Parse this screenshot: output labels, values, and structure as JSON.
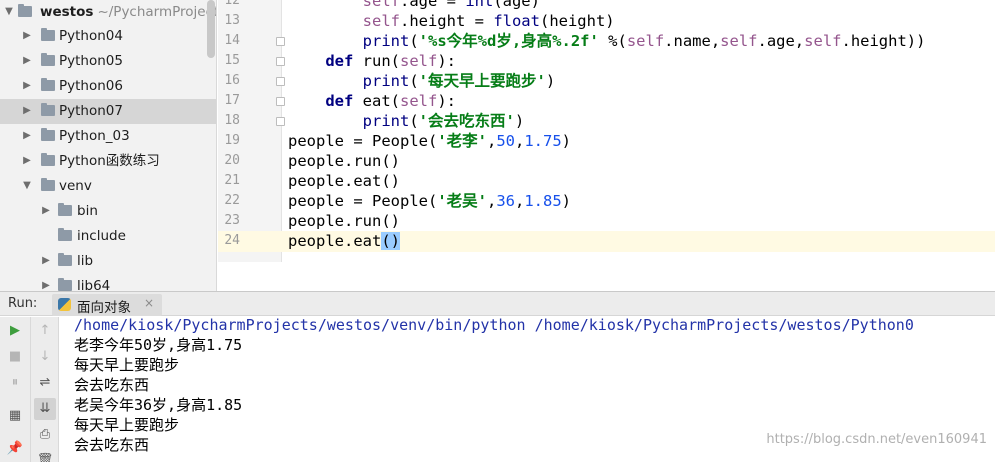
{
  "project_tree": {
    "root": {
      "name": "westos",
      "path": "~/PycharmProjects"
    },
    "items": [
      {
        "label": "Python04",
        "selected": false,
        "arrow": "▶"
      },
      {
        "label": "Python05",
        "selected": false,
        "arrow": "▶"
      },
      {
        "label": "Python06",
        "selected": false,
        "arrow": "▶"
      },
      {
        "label": "Python07",
        "selected": true,
        "arrow": "▶"
      },
      {
        "label": "Python_03",
        "selected": false,
        "arrow": "▶"
      },
      {
        "label": "Python函数练习",
        "selected": false,
        "arrow": "▶"
      },
      {
        "label": "venv",
        "selected": false,
        "arrow": "▼"
      },
      {
        "label": "bin",
        "selected": false,
        "arrow": "▶"
      },
      {
        "label": "include",
        "selected": false,
        "arrow": ""
      },
      {
        "label": "lib",
        "selected": false,
        "arrow": "▶"
      },
      {
        "label": "lib64",
        "selected": false,
        "arrow": "▶"
      }
    ]
  },
  "editor": {
    "line_numbers": [
      "13",
      "14",
      "15",
      "16",
      "17",
      "18",
      "19",
      "20",
      "21",
      "22",
      "23",
      "24"
    ],
    "current_line": "24",
    "top_partial_line": "self.age = int(age)"
  },
  "run_panel": {
    "title": "Run:",
    "tab_label": "面向对象",
    "tab_close": "×",
    "command": "/home/kiosk/PycharmProjects/westos/venv/bin/python /home/kiosk/PycharmProjects/westos/Python0",
    "output_lines": [
      "老李今年50岁,身高1.75",
      "每天早上要跑步",
      "会去吃东西",
      "老吴今年36岁,身高1.85",
      "每天早上要跑步",
      "会去吃东西"
    ]
  },
  "icons": {
    "run": "run-icon",
    "stop": "stop-icon",
    "pause": "pause-icon",
    "layout": "layout-icon",
    "pin": "pin-icon",
    "up": "arrow-up-icon",
    "down": "arrow-down-icon",
    "wrap": "soft-wrap-icon",
    "scroll_end": "scroll-to-end-icon",
    "print": "print-icon",
    "trash": "trash-icon"
  },
  "watermark": "https://blog.csdn.net/even160941",
  "colors": {
    "keyword": "#000080",
    "self": "#94558d",
    "string": "#067d17",
    "number": "#1750eb",
    "selection": "#d6d6d6",
    "current_line": "#fffae3"
  }
}
